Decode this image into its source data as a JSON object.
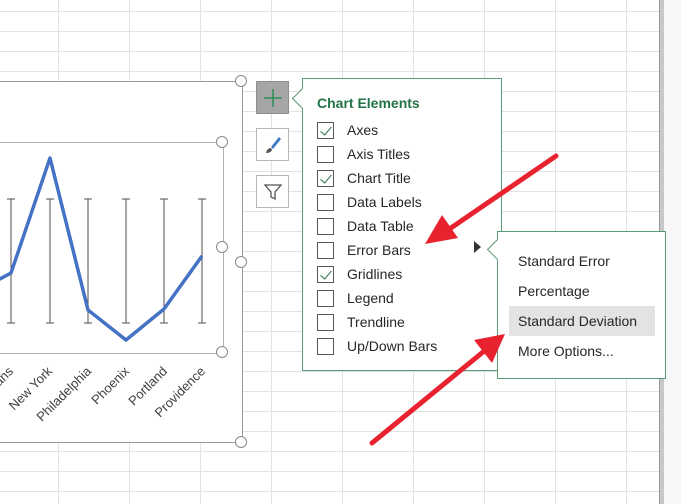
{
  "chart": {
    "categories": [
      "Orleans",
      "New York",
      "Philadelphia",
      "Phoenix",
      "Portland",
      "Providence"
    ],
    "line_color": "#4472c4"
  },
  "panel": {
    "title": "Chart Elements",
    "items": [
      {
        "label": "Axes",
        "checked": true
      },
      {
        "label": "Axis Titles",
        "checked": false
      },
      {
        "label": "Chart Title",
        "checked": true
      },
      {
        "label": "Data Labels",
        "checked": false
      },
      {
        "label": "Data Table",
        "checked": false
      },
      {
        "label": "Error Bars",
        "checked": false
      },
      {
        "label": "Gridlines",
        "checked": true
      },
      {
        "label": "Legend",
        "checked": false
      },
      {
        "label": "Trendline",
        "checked": false
      },
      {
        "label": "Up/Down Bars",
        "checked": false
      }
    ]
  },
  "submenu": {
    "items": [
      "Standard Error",
      "Percentage",
      "Standard Deviation",
      "More Options..."
    ],
    "highlighted": "Standard Deviation"
  },
  "side_buttons": [
    "add-chart-element-icon",
    "chart-styles-brush-icon",
    "chart-filter-icon"
  ],
  "colors": {
    "accent": "#217346",
    "arrow": "#e8232f",
    "panel_border": "#5a9a74"
  }
}
